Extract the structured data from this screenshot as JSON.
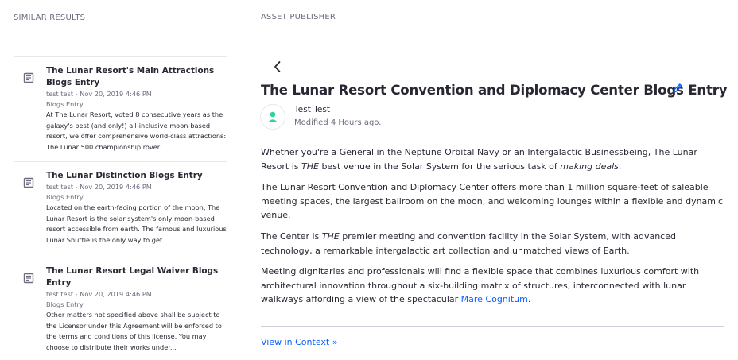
{
  "similar": {
    "title": "SIMILAR RESULTS",
    "items": [
      {
        "icon": "blog-entry-icon",
        "title": "The Lunar Resort's Main Attractions Blogs Entry",
        "meta": "test test - Nov 20, 2019 4:46 PM",
        "type": "Blogs Entry",
        "description": "At The Lunar Resort, voted 8 consecutive years as the galaxy's best (and only!) all-inclusive moon-based resort, we offer comprehensive world-class attractions: The Lunar 500 championship rover..."
      },
      {
        "icon": "blog-entry-icon",
        "title": "The Lunar Distinction Blogs Entry",
        "meta": "test test - Nov 20, 2019 4:46 PM",
        "type": "Blogs Entry",
        "description": "Located on the earth-facing portion of the moon, The Lunar Resort is the solar system's only moon-based resort accessible from earth. The famous and luxurious Lunar Shuttle is the only way to get..."
      },
      {
        "icon": "blog-entry-icon",
        "title": "The Lunar Resort Legal Waiver Blogs Entry",
        "meta": "test test - Nov 20, 2019 4:46 PM",
        "type": "Blogs Entry",
        "description": "Other matters not specified above shall be subject to the Licensor under this Agreement will be enforced to the terms and conditions of this license. You may choose to distribute their works under..."
      }
    ]
  },
  "asset": {
    "section_title": "ASSET PUBLISHER",
    "entry_title": "The Lunar Resort Convention and Diplomacy Center Blogs Entry",
    "author": "Test Test",
    "modified": "Modified 4 Hours ago.",
    "paragraphs": {
      "p1_a": "Whether you're a General in the Neptune Orbital Navy or an Intergalactic Businessbeing, The Lunar Resort is ",
      "p1_em1": "THE",
      "p1_b": " best venue in the Solar System for the serious task of ",
      "p1_em2": "making deals",
      "p1_c": ".",
      "p2": "The Lunar Resort Convention and Diplomacy Center offers more than 1 million square-feet of saleable meeting spaces, the largest ballroom on the moon, and welcoming lounges within a flexible and dynamic venue.",
      "p3_a": "The Center is ",
      "p3_em": "THE",
      "p3_b": " premier meeting and convention facility in the Solar System, with advanced technology, a remarkable intergalactic art collection and unmatched views of Earth.",
      "p4_a": "Meeting dignitaries and professionals will find a flexible space that combines luxurious comfort with architectural innovation throughout a six-building matrix of structures, interconnected with lunar walkways affording a view of the spectacular ",
      "p4_link": "Mare Cognitum",
      "p4_b": "."
    },
    "view_in_context": "View in Context »"
  },
  "colors": {
    "link": "#0b5fff",
    "avatar_accent": "#2bd4a0",
    "muted": "#6b6c7e"
  }
}
